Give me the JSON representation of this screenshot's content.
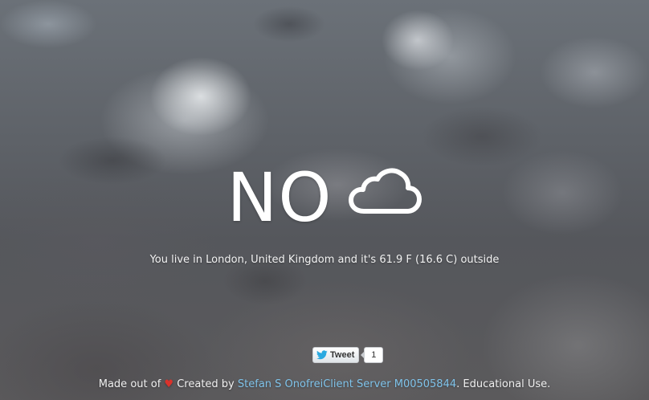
{
  "answer": {
    "text": "NO",
    "icon": "cloud-icon"
  },
  "info": {
    "text": "You live in London, United Kingdom and it's 61.9 F (16.6 C) outside"
  },
  "share": {
    "tweet_label": "Tweet",
    "tweet_count": "1",
    "icon": "twitter-bird-icon"
  },
  "footer": {
    "made_out_of": "Made out of",
    "heart": "♥",
    "created_by": "Created by",
    "author": "Stefan S OnofreiClient Server M00505844",
    "suffix": ". Educational Use."
  },
  "colors": {
    "link": "#7fc3ea",
    "heart": "#d9322b",
    "twitter": "#2aa9e0"
  }
}
